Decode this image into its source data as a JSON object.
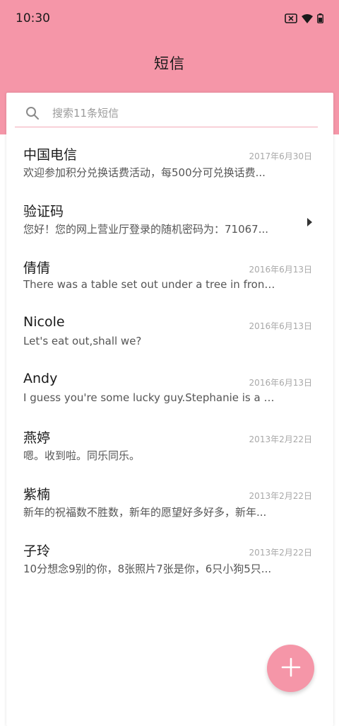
{
  "status_bar": {
    "time": "10:30"
  },
  "header": {
    "title": "短信"
  },
  "search": {
    "placeholder": "搜索11条短信"
  },
  "messages": [
    {
      "sender": "中国电信",
      "date": "2017年6月30日",
      "preview": "欢迎参加积分兑换话费活动，每500分可兑换话费..."
    },
    {
      "sender": "验证码",
      "date": "",
      "preview": "您好！您的网上营业厅登录的随机密码为：71067..."
    },
    {
      "sender": "倩倩",
      "date": "2016年6月13日",
      "preview": "There was a table set out under a tree in front o..."
    },
    {
      "sender": "Nicole",
      "date": "2016年6月13日",
      "preview": "Let's eat out,shall we?"
    },
    {
      "sender": "Andy",
      "date": "2016年6月13日",
      "preview": "I guess you're some lucky guy.Stephanie is a ni..."
    },
    {
      "sender": "燕婷",
      "date": "2013年2月22日",
      "preview": "嗯。收到啦。同乐同乐。"
    },
    {
      "sender": "紫楠",
      "date": "2013年2月22日",
      "preview": "新年的祝福数不胜数，新年的愿望好多好多，新年..."
    },
    {
      "sender": "子玲",
      "date": "2013年2月22日",
      "preview": "10分想念9别的你，8张照片7张是你，6只小狗5只..."
    }
  ],
  "colors": {
    "accent": "#f596a8",
    "divider": "#f2a9b7"
  },
  "icons": {
    "search": "search-icon",
    "fab": "add-icon",
    "expand": "chevron-right-icon"
  }
}
